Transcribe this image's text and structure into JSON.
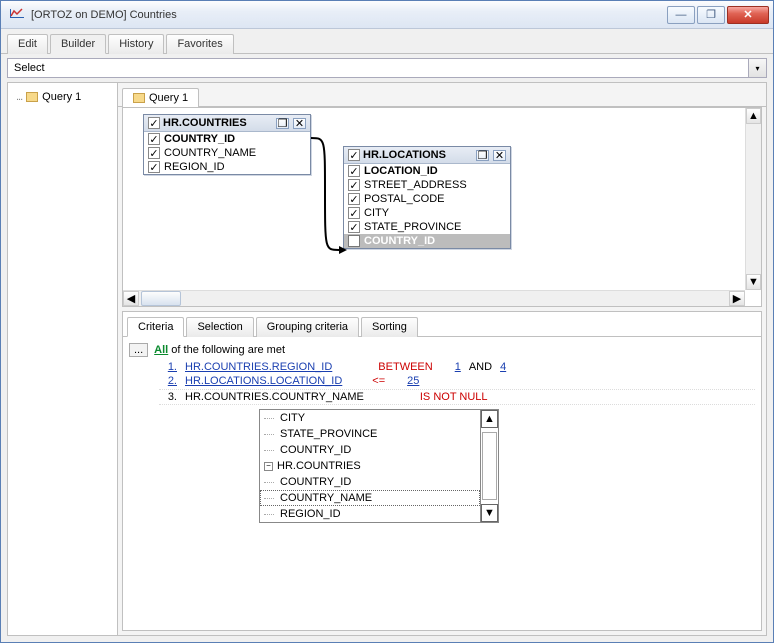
{
  "window": {
    "title": "[ORTOZ on DEMO] Countries"
  },
  "topTabs": {
    "edit": "Edit",
    "builder": "Builder",
    "history": "History",
    "favorites": "Favorites"
  },
  "selectBar": {
    "text": "Select"
  },
  "tree": {
    "query1": "Query 1"
  },
  "innerTab": {
    "query1": "Query 1"
  },
  "tables": {
    "countries": {
      "name": "HR.COUNTRIES",
      "cols": {
        "c1": "COUNTRY_ID",
        "c2": "COUNTRY_NAME",
        "c3": "REGION_ID"
      }
    },
    "locations": {
      "name": "HR.LOCATIONS",
      "cols": {
        "l1": "LOCATION_ID",
        "l2": "STREET_ADDRESS",
        "l3": "POSTAL_CODE",
        "l4": "CITY",
        "l5": "STATE_PROVINCE",
        "l6": "COUNTRY_ID"
      }
    }
  },
  "criteriaTabs": {
    "criteria": "Criteria",
    "selection": "Selection",
    "grouping": "Grouping criteria",
    "sorting": "Sorting"
  },
  "criteria": {
    "all": "All",
    "rest": " of the following are met",
    "r1": {
      "n": "1.",
      "field": "HR.COUNTRIES.REGION_ID",
      "op": "BETWEEN",
      "v1": "1",
      "and": "AND",
      "v2": "4"
    },
    "r2": {
      "n": "2.",
      "field": "HR.LOCATIONS.LOCATION_ID",
      "op": "<=",
      "v1": "25"
    },
    "r3": {
      "n": "3.",
      "field": "HR.COUNTRIES.COUNTRY_NAME",
      "op": "IS NOT NULL"
    }
  },
  "suggest": {
    "city": "CITY",
    "state": "STATE_PROVINCE",
    "cid": "COUNTRY_ID",
    "grp": "HR.COUNTRIES",
    "g1": "COUNTRY_ID",
    "g2": "COUNTRY_NAME",
    "g3": "REGION_ID"
  },
  "glyphs": {
    "check": "✓",
    "up": "▲",
    "down": "▼",
    "left": "◀",
    "right": "▶",
    "minus": "−",
    "restore": "❐",
    "close": "✕",
    "min": "—",
    "dots": "...",
    "chevdown": "▾"
  }
}
